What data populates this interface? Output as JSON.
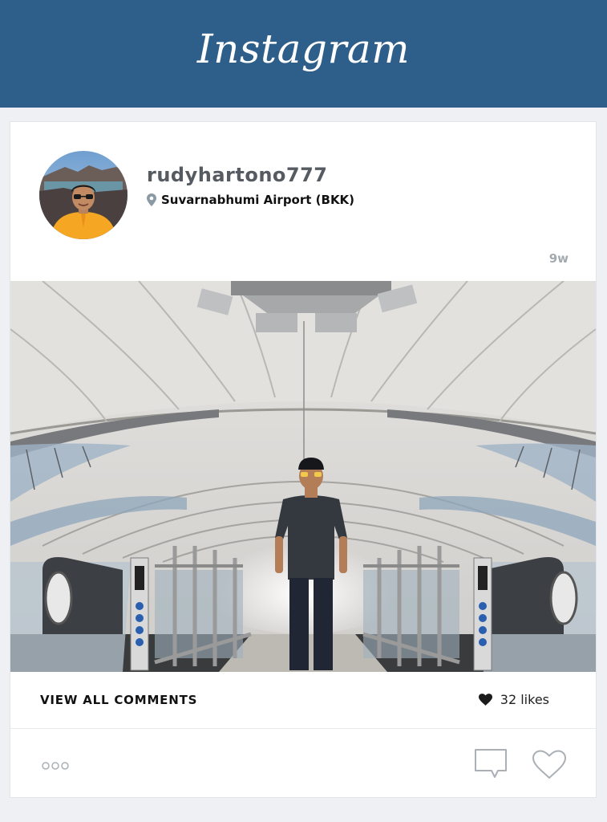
{
  "header": {
    "brand": "Instagram",
    "background": "#2e5f8b"
  },
  "post": {
    "username": "rudyhartono777",
    "location": "Suvarnabhumi Airport (BKK)",
    "time": "9w",
    "view_all_comments": "VIEW ALL COMMENTS",
    "likes": "32 likes",
    "icons": {
      "location": "location-pin-icon",
      "likes": "heart-filled-icon",
      "more": "more-dots-icon",
      "comment": "comment-icon",
      "like": "heart-outline-icon"
    }
  }
}
